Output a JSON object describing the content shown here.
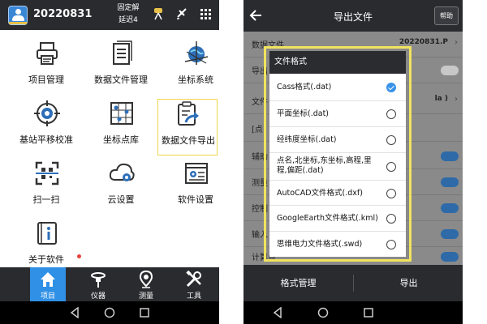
{
  "left": {
    "header": {
      "project_id": "20220831",
      "fix_status": "固定解",
      "delay": "延迟4"
    },
    "tiles": [
      {
        "label": "项目管理",
        "icon": "printer-icon"
      },
      {
        "label": "数据文件管理",
        "icon": "document-list-icon"
      },
      {
        "label": "坐标系统",
        "icon": "globe-axes-icon"
      },
      {
        "label": "基站平移校准",
        "icon": "target-crosshair-icon"
      },
      {
        "label": "坐标点库",
        "icon": "map-grid-icon"
      },
      {
        "label": "数据文件导出",
        "icon": "clipboard-export-icon",
        "selected": true
      },
      {
        "label": "扫一扫",
        "icon": "qr-scan-icon"
      },
      {
        "label": "云设置",
        "icon": "cloud-settings-icon"
      },
      {
        "label": "软件设置",
        "icon": "settings-panel-icon"
      },
      {
        "label": "关于软件",
        "icon": "info-book-icon",
        "badge": true
      }
    ],
    "tabs": [
      {
        "label": "项目",
        "icon": "home-icon",
        "active": true
      },
      {
        "label": "仪器",
        "icon": "receiver-icon"
      },
      {
        "label": "测量",
        "icon": "location-pin-icon"
      },
      {
        "label": "工具",
        "icon": "tools-icon"
      }
    ]
  },
  "right": {
    "header": {
      "title": "导出文件",
      "help_label": "帮助"
    },
    "background_rows": [
      {
        "label": "数据文件",
        "value": "20220831.P"
      },
      {
        "label": "导出",
        "value": ""
      },
      {
        "label": "文件",
        "value": "la )"
      },
      {
        "label": "[点",
        "value": ""
      },
      {
        "label": "辅助",
        "value": ""
      },
      {
        "label": "测量",
        "value": ""
      },
      {
        "label": "控制",
        "value": ""
      },
      {
        "label": "输入",
        "value": ""
      },
      {
        "label": "计算点",
        "value": ""
      }
    ],
    "dialog": {
      "title": "文件格式",
      "options": [
        {
          "label": "Cass格式(.dat)",
          "checked": true
        },
        {
          "label": "平面坐标(.dat)",
          "checked": false
        },
        {
          "label": "经纬度坐标(.dat)",
          "checked": false
        },
        {
          "label": "点名,北坐标,东坐标,高程,里程,偏距(.dat)",
          "checked": false
        },
        {
          "label": "AutoCAD文件格式(.dxf)",
          "checked": false
        },
        {
          "label": "GoogleEarth文件格式(.kml)",
          "checked": false
        },
        {
          "label": "思维电力文件格式(.swd)",
          "checked": false
        }
      ]
    },
    "bottom": {
      "manage_label": "格式管理",
      "export_label": "导出"
    }
  },
  "colors": {
    "header_bg": "#2a2b2f",
    "accent_blue": "#3090e6",
    "highlight_yellow": "#f1e35e"
  }
}
